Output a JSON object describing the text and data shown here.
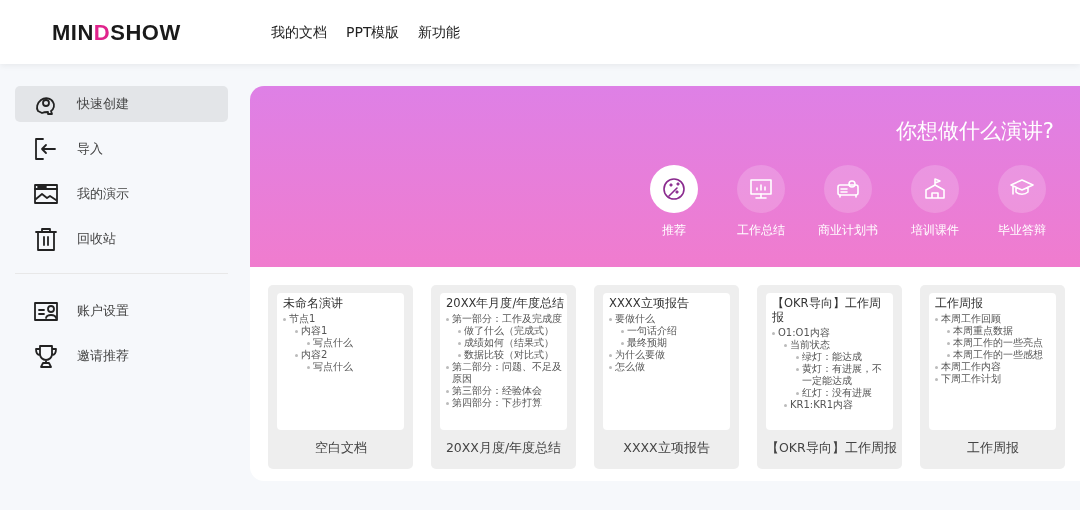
{
  "header": {
    "logo": "MINDSHOW",
    "nav": [
      {
        "label": "我的文档"
      },
      {
        "label": "PPT模版"
      },
      {
        "label": "新功能"
      }
    ]
  },
  "sidebar": {
    "items": [
      {
        "label": "快速创建",
        "selected": true
      },
      {
        "label": "导入",
        "selected": false
      },
      {
        "label": "我的演示",
        "selected": false
      },
      {
        "label": "回收站",
        "selected": false
      }
    ],
    "items_secondary": [
      {
        "label": "账户设置",
        "selected": false
      },
      {
        "label": "邀请推荐",
        "selected": false
      }
    ]
  },
  "banner": {
    "title": "你想做什么演讲?",
    "categories": [
      {
        "label": "推荐",
        "selected": true
      },
      {
        "label": "工作总结",
        "selected": false
      },
      {
        "label": "商业计划书",
        "selected": false
      },
      {
        "label": "培训课件",
        "selected": false
      },
      {
        "label": "毕业答辩",
        "selected": false
      }
    ]
  },
  "templates": [
    {
      "preview_title": "未命名演讲",
      "outline": [
        {
          "text": "节点1",
          "children": [
            {
              "text": "内容1",
              "children": [
                {
                  "text": "写点什么"
                }
              ]
            },
            {
              "text": "内容2",
              "children": [
                {
                  "text": "写点什么"
                }
              ]
            }
          ]
        }
      ],
      "name": "空白文档"
    },
    {
      "preview_title": "20XX年月度/年度总结",
      "outline": [
        {
          "text": "第一部分：工作及完成度",
          "children": [
            {
              "text": "做了什么（完成式）"
            },
            {
              "text": "成绩如何（结果式）"
            },
            {
              "text": "数据比较（对比式）"
            }
          ]
        },
        {
          "text": "第二部分：问题、不足及原因"
        },
        {
          "text": "第三部分：经验体会"
        },
        {
          "text": "第四部分：下步打算"
        }
      ],
      "name": "20XX月度/年度总结"
    },
    {
      "preview_title": "XXXX立项报告",
      "outline": [
        {
          "text": "要做什么",
          "children": [
            {
              "text": "一句话介绍"
            },
            {
              "text": "最终预期"
            }
          ]
        },
        {
          "text": "为什么要做"
        },
        {
          "text": "怎么做"
        }
      ],
      "name": "XXXX立项报告"
    },
    {
      "preview_title": "【OKR导向】工作周报",
      "outline": [
        {
          "text": "O1:O1内容",
          "children": [
            {
              "text": "当前状态",
              "children": [
                {
                  "text": "绿灯：能达成"
                },
                {
                  "text": "黄灯：有进展，不一定能达成"
                },
                {
                  "text": "红灯：没有进展"
                }
              ]
            },
            {
              "text": "KR1:KR1内容"
            }
          ]
        }
      ],
      "name": "【OKR导向】工作周报"
    },
    {
      "preview_title": "工作周报",
      "outline": [
        {
          "text": "本周工作回顾",
          "children": [
            {
              "text": "本周重点数据"
            },
            {
              "text": "本周工作的一些亮点"
            },
            {
              "text": "本周工作的一些感想"
            }
          ]
        },
        {
          "text": "本周工作内容"
        },
        {
          "text": "下周工作计划"
        }
      ],
      "name": "工作周报"
    }
  ]
}
